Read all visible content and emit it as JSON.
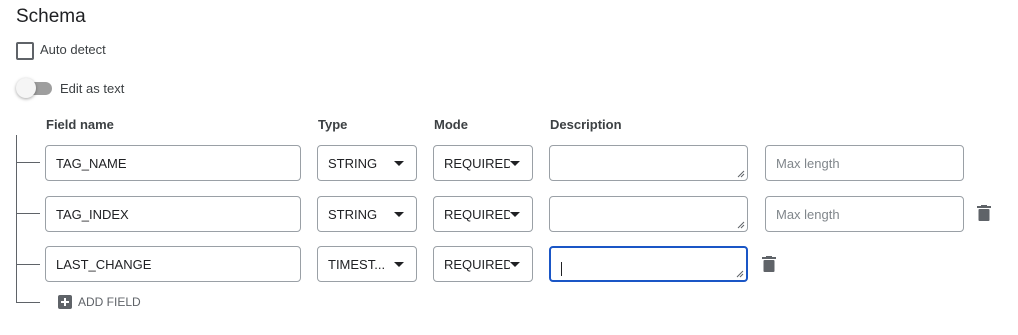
{
  "schema": {
    "title": "Schema",
    "auto_detect": {
      "label": "Auto detect",
      "checked": false
    },
    "edit_as_text": {
      "label": "Edit as text",
      "on": false
    },
    "columns": {
      "field_name": "Field name",
      "type": "Type",
      "mode": "Mode",
      "description": "Description"
    },
    "rows": [
      {
        "name": "TAG_NAME",
        "type": "STRING",
        "mode": "REQUIRED",
        "description": "",
        "max_length_placeholder": "Max length"
      },
      {
        "name": "TAG_INDEX",
        "type": "STRING",
        "mode": "REQUIRED",
        "description": "",
        "max_length_placeholder": "Max length"
      },
      {
        "name": "LAST_CHANGE",
        "type": "TIMEST...",
        "mode": "REQUIRED",
        "description": ""
      }
    ],
    "add_field_label": "ADD FIELD"
  },
  "colors": {
    "focus": "#1a56c6",
    "icon": "#5f6368"
  },
  "icons": {
    "delete": "trash-icon",
    "add": "plus-icon",
    "dropdown": "caret-down-icon"
  }
}
